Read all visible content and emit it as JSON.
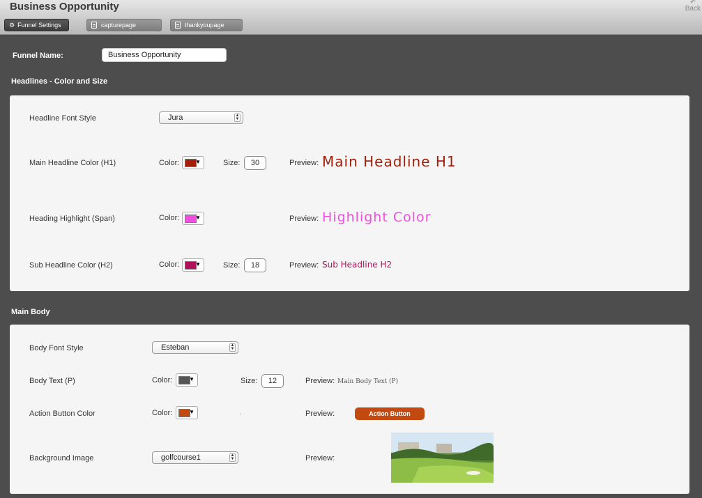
{
  "app": {
    "title": "Business Opportunity",
    "back_label": "Back"
  },
  "tabs": [
    {
      "label": "Funnel Settings",
      "active": true,
      "icon": "gear-icon"
    },
    {
      "label": "capturepage",
      "active": false,
      "icon": "page-icon"
    },
    {
      "label": "thankyoupage",
      "active": false,
      "icon": "page-icon"
    }
  ],
  "funnel": {
    "label": "Funnel Name:",
    "value": "Business Opportunity"
  },
  "headlines": {
    "section_title": "Headlines - Color and Size",
    "font_style": {
      "label": "Headline Font Style",
      "value": "Jura"
    },
    "h1": {
      "label": "Main Headline Color (H1)",
      "color_label": "Color:",
      "color": "#a31f0c",
      "size_label": "Size:",
      "size": "30",
      "preview_label": "Preview:",
      "preview_text": "Main Headline H1"
    },
    "span": {
      "label": "Heading Highlight (Span)",
      "color_label": "Color:",
      "color": "#f050e0",
      "preview_label": "Preview:",
      "preview_text": "Highlight Color"
    },
    "h2": {
      "label": "Sub Headline Color (H2)",
      "color_label": "Color:",
      "color": "#b0105a",
      "size_label": "Size:",
      "size": "18",
      "preview_label": "Preview:",
      "preview_text": "Sub Headline H2"
    }
  },
  "body": {
    "section_title": "Main Body",
    "font_style": {
      "label": "Body Font Style",
      "value": "Esteban"
    },
    "text": {
      "label": "Body Text (P)",
      "color_label": "Color:",
      "color": "#555555",
      "size_label": "Size:",
      "size": "12",
      "preview_label": "Preview:",
      "preview_text": "Main Body Text (P)"
    },
    "button": {
      "label": "Action Button Color",
      "color_label": "Color:",
      "color": "#c24a10",
      "dot": ".",
      "preview_label": "Preview:",
      "preview_text": "Action Button"
    },
    "background": {
      "label": "Background Image",
      "value": "golfcourse1",
      "preview_label": "Preview:"
    }
  }
}
